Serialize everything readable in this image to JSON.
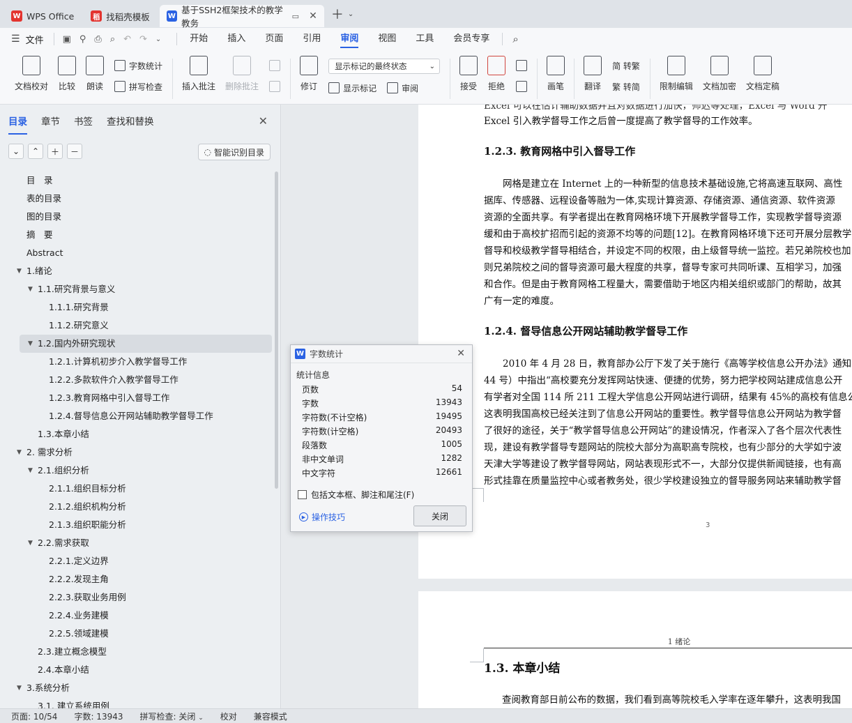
{
  "tabs": [
    {
      "label": "WPS Office",
      "icon": "wps-logo-icon",
      "color": "#e3342f"
    },
    {
      "label": "找稻壳模板",
      "icon": "docer-logo-icon",
      "color": "#e3342f"
    },
    {
      "label": "基于SSH2框架技术的教学教务",
      "icon": "word-doc-icon",
      "color": "#2b62e3",
      "active": true
    }
  ],
  "menu": {
    "file": "文件",
    "items": [
      "开始",
      "插入",
      "页面",
      "引用",
      "审阅",
      "视图",
      "工具",
      "会员专享"
    ],
    "active": "审阅"
  },
  "ribbon": {
    "doc_check": "文档校对",
    "compare": "比较",
    "read_aloud": "朗读",
    "word_count": "字数统计",
    "spell_check": "拼写检查",
    "insert_comment": "插入批注",
    "delete_comment": "删除批注",
    "revise": "修订",
    "display_mode": "显示标记的最终状态",
    "show_markup": "显示标记",
    "review": "审阅",
    "accept": "接受",
    "reject": "拒绝",
    "pen": "画笔",
    "translate": "翻译",
    "to_traditional": "简 转繁",
    "to_simplified": "繁 转简",
    "restrict_edit": "限制编辑",
    "encrypt": "文档加密",
    "finalize": "文档定稿"
  },
  "sidebar": {
    "tabs": [
      "目录",
      "章节",
      "书签",
      "查找和替换"
    ],
    "active_tab": "目录",
    "smart_button": "智能识别目录",
    "toc": [
      {
        "text": "目　录",
        "level": 1,
        "arrow": ""
      },
      {
        "text": "表的目录",
        "level": 1,
        "arrow": ""
      },
      {
        "text": "图的目录",
        "level": 1,
        "arrow": ""
      },
      {
        "text": "摘　要",
        "level": 1,
        "arrow": ""
      },
      {
        "text": "Abstract",
        "level": 1,
        "arrow": ""
      },
      {
        "text": "1.绪论",
        "level": 1,
        "arrow": "▼"
      },
      {
        "text": "1.1.研究背景与意义",
        "level": 2,
        "arrow": "▼"
      },
      {
        "text": "1.1.1.研究背景",
        "level": 3,
        "arrow": ""
      },
      {
        "text": "1.1.2.研究意义",
        "level": 3,
        "arrow": ""
      },
      {
        "text": "1.2.国内外研究现状",
        "level": 2,
        "arrow": "▼",
        "selected": true
      },
      {
        "text": "1.2.1.计算机初步介入教学督导工作",
        "level": 3,
        "arrow": ""
      },
      {
        "text": "1.2.2.多款软件介入教学督导工作",
        "level": 3,
        "arrow": ""
      },
      {
        "text": "1.2.3.教育网格中引入督导工作",
        "level": 3,
        "arrow": ""
      },
      {
        "text": "1.2.4.督导信息公开网站辅助教学督导工作",
        "level": 3,
        "arrow": ""
      },
      {
        "text": "1.3.本章小结",
        "level": 2,
        "arrow": ""
      },
      {
        "text": "2. 需求分析",
        "level": 1,
        "arrow": "▼"
      },
      {
        "text": "2.1.组织分析",
        "level": 2,
        "arrow": "▼"
      },
      {
        "text": "2.1.1.组织目标分析",
        "level": 3,
        "arrow": ""
      },
      {
        "text": "2.1.2.组织机构分析",
        "level": 3,
        "arrow": ""
      },
      {
        "text": "2.1.3.组织职能分析",
        "level": 3,
        "arrow": ""
      },
      {
        "text": "2.2.需求获取",
        "level": 2,
        "arrow": "▼"
      },
      {
        "text": "2.2.1.定义边界",
        "level": 3,
        "arrow": ""
      },
      {
        "text": "2.2.2.发现主角",
        "level": 3,
        "arrow": ""
      },
      {
        "text": "2.2.3.获取业务用例",
        "level": 3,
        "arrow": ""
      },
      {
        "text": "2.2.4.业务建模",
        "level": 3,
        "arrow": ""
      },
      {
        "text": "2.2.5.领域建模",
        "level": 3,
        "arrow": ""
      },
      {
        "text": "2.3.建立概念模型",
        "level": 2,
        "arrow": ""
      },
      {
        "text": "2.4.本章小结",
        "level": 2,
        "arrow": ""
      },
      {
        "text": "3.系统分析",
        "level": 1,
        "arrow": "▼"
      },
      {
        "text": "3.1. 建立系统用例",
        "level": 2,
        "arrow": ""
      }
    ]
  },
  "document": {
    "page1": {
      "lines": [
        "Excel 可以在估计辅助数据并且对数据进行加快，师迟等处理，Excel 与 Word 升",
        "Excel 引入教学督导工作之后曾一度提高了教学督导的工作效率。"
      ],
      "heading_123": "1.2.3.  教育网格中引入督导工作",
      "para_123": [
        "网格是建立在  Internet 上的一种新型的信息技术基础设施,它将高速互联网、高性",
        "据库、传感器、远程设备等融为一体,实现计算资源、存储资源、通信资源、软件资源",
        "资源的全面共享。有学者提出在教育网格环境下开展教学督导工作，实现教学督导资源",
        "缓和由于高校扩招而引起的资源不均等的问题[12]。在教育网格环境下还可开展分层教学",
        "督导和校级教学督导相结合，并设定不同的权限，由上级督导统一监控。若兄弟院校也加",
        "则兄弟院校之间的督导资源可最大程度的共享，督导专家可共同听课、互相学习，加强",
        "和合作。但是由于教育网格工程量大，需要借助于地区内相关组织或部门的帮助，故其",
        "广有一定的难度。"
      ],
      "heading_124": "1.2.4.  督导信息公开网站辅助教学督导工作",
      "para_124": [
        "2010 年 4 月 28 日，教育部办公厅下发了关于施行《高等学校信息公开办法》通知",
        "44 号）中指出“高校要充分发挥网站快速、便捷的优势，努力把学校网站建成信息公开",
        "有学者对全国 114 所 211 工程大学信息公开网站进行调研，结果有 45%的高校有信息公",
        "这表明我国高校已经关注到了信息公开网站的重要性。教学督导信息公开网站为教学督",
        "了很好的途径，关于“教学督导信息公开网站”的建设情况，作者深入了各个层次代表性",
        "现，建设有教学督导专题网站的院校大部分为高职高专院校，也有少部分的大学如宁波",
        "天津大学等建设了教学督导网站，网站表现形式不一，大部分仅提供新闻链接，也有高",
        "形式挂靠在质量监控中心或者教务处，很少学校建设独立的督导服务网站来辅助教学督"
      ],
      "page_number": "3"
    },
    "page2": {
      "header": "1  绪论",
      "heading": "1.3.    本章小结",
      "para": "查阅教育部日前公布的数据，我们看到高等院校毛入学率在逐年攀升，这表明我国"
    }
  },
  "dialog": {
    "title": "字数统计",
    "section": "统计信息",
    "stats": [
      {
        "label": "页数",
        "value": "54"
      },
      {
        "label": "字数",
        "value": "13943"
      },
      {
        "label": "字符数(不计空格)",
        "value": "19495"
      },
      {
        "label": "字符数(计空格)",
        "value": "20493"
      },
      {
        "label": "段落数",
        "value": "1005"
      },
      {
        "label": "非中文单词",
        "value": "1282"
      },
      {
        "label": "中文字符",
        "value": "12661"
      }
    ],
    "checkbox_label": "包括文本框、脚注和尾注(F)",
    "tips": "操作技巧",
    "close": "关闭"
  },
  "status": {
    "page": "页面: 10/54",
    "words": "字数: 13943",
    "spell": "拼写检查: 关闭",
    "proof": "校对",
    "compat": "兼容模式"
  }
}
